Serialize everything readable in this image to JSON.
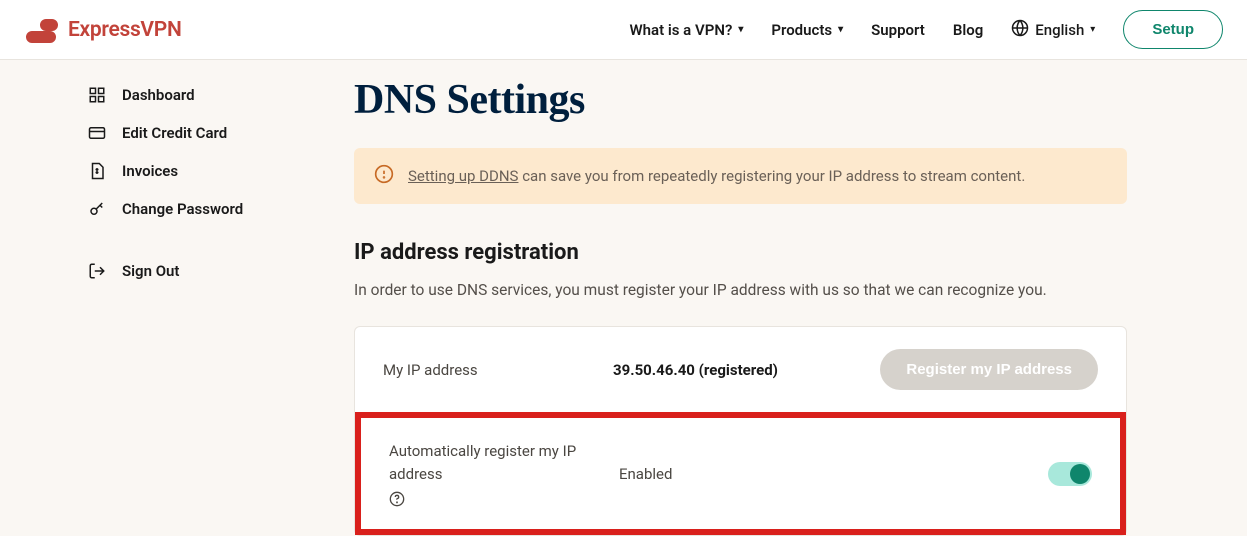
{
  "header": {
    "brand": "ExpressVPN",
    "nav": {
      "vpn": "What is a VPN?",
      "products": "Products",
      "support": "Support",
      "blog": "Blog",
      "language": "English"
    },
    "setup": "Setup"
  },
  "sidebar": {
    "dashboard": "Dashboard",
    "edit_card": "Edit Credit Card",
    "invoices": "Invoices",
    "change_password": "Change Password",
    "sign_out": "Sign Out"
  },
  "main": {
    "title": "DNS Settings",
    "alert_link": "Setting up DDNS",
    "alert_rest": " can save you from repeatedly registering your IP address to stream content.",
    "section_title": "IP address registration",
    "section_desc": "In order to use DNS services, you must register your IP address with us so that we can recognize you.",
    "ip_row": {
      "label": "My IP address",
      "value": "39.50.46.40 (registered)",
      "button": "Register my IP address"
    },
    "auto_row": {
      "label": "Automatically register my IP address",
      "value": "Enabled"
    }
  }
}
